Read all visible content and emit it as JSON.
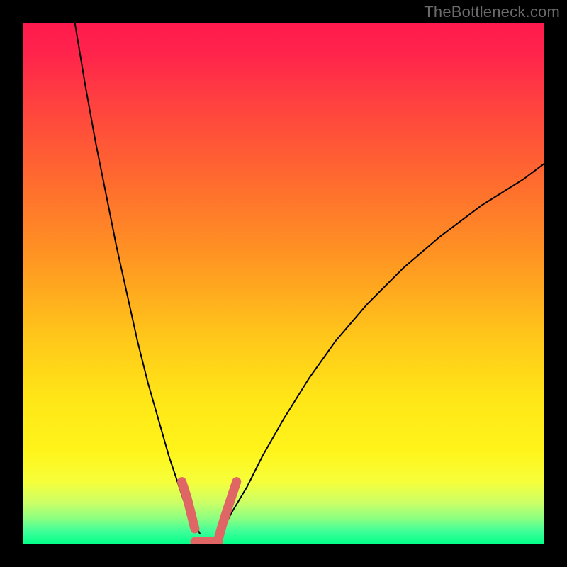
{
  "watermark": "TheBottleneck.com",
  "colors": {
    "frame": "#000000",
    "curve": "#000000",
    "marker": "#e06666",
    "gradient_top": "#ff1a4d",
    "gradient_mid": "#ffe617",
    "gradient_bottom": "#00ff88"
  },
  "chart_data": {
    "type": "line",
    "title": "",
    "xlabel": "",
    "ylabel": "",
    "xlim": [
      0,
      100
    ],
    "ylim": [
      0,
      100
    ],
    "grid": false,
    "legend": false,
    "series": [
      {
        "name": "left-curve",
        "x": [
          10,
          12,
          14,
          16,
          18,
          20,
          22,
          24,
          26,
          28,
          30,
          31,
          32,
          33,
          34
        ],
        "y": [
          100,
          88,
          77,
          67,
          57,
          48,
          39,
          31,
          24,
          17,
          11,
          8,
          6,
          4,
          2
        ]
      },
      {
        "name": "right-curve",
        "x": [
          37,
          38,
          40,
          43,
          46,
          50,
          55,
          60,
          66,
          73,
          80,
          88,
          96,
          100
        ],
        "y": [
          0,
          2,
          6,
          11,
          17,
          24,
          32,
          39,
          46,
          53,
          59,
          65,
          70,
          73
        ]
      },
      {
        "name": "marker-left-descent",
        "x": [
          30.5,
          31.5,
          32.0,
          32.5,
          33.0
        ],
        "y": [
          12.0,
          9.0,
          7.0,
          5.0,
          3.0
        ]
      },
      {
        "name": "marker-valley",
        "x": [
          33.0,
          34.5,
          36.0,
          37.5
        ],
        "y": [
          0.5,
          0.5,
          0.5,
          0.5
        ]
      },
      {
        "name": "marker-right-ascent",
        "x": [
          37.5,
          38.2,
          39.0,
          40.0,
          41.0
        ],
        "y": [
          1.0,
          3.5,
          6.0,
          9.0,
          12.0
        ]
      }
    ],
    "annotations": [
      {
        "text": "TheBottleneck.com",
        "position": "top-right"
      }
    ]
  }
}
